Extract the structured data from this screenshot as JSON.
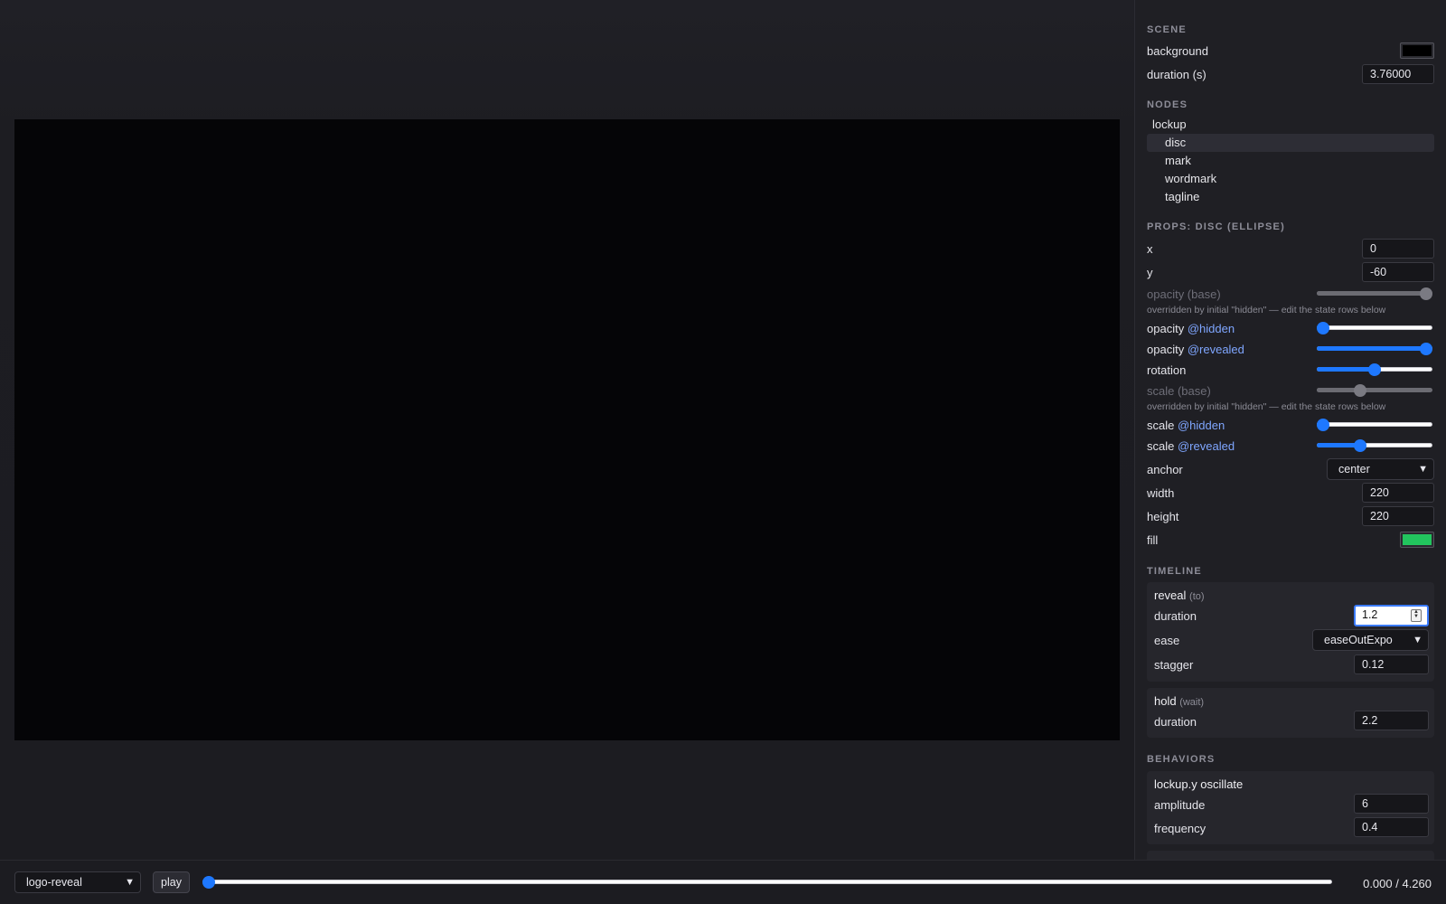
{
  "scene": {
    "title": "SCENE",
    "background_label": "background",
    "background_color": "#000000",
    "duration_label": "duration (s)",
    "duration_value": "3.76000"
  },
  "nodes": {
    "title": "NODES",
    "items": [
      {
        "label": "lockup",
        "depth": 0,
        "selected": false
      },
      {
        "label": "disc",
        "depth": 1,
        "selected": true
      },
      {
        "label": "mark",
        "depth": 1,
        "selected": false
      },
      {
        "label": "wordmark",
        "depth": 1,
        "selected": false
      },
      {
        "label": "tagline",
        "depth": 1,
        "selected": false
      }
    ]
  },
  "props": {
    "title": "PROPS: DISC (ELLIPSE)",
    "x_label": "x",
    "x_value": "0",
    "y_label": "y",
    "y_value": "-60",
    "override_note": "overridden by initial \"hidden\" — edit the state rows below",
    "opacity_base_label": "opacity (base)",
    "opacity_label": "opacity",
    "hidden_state": "@hidden",
    "revealed_state": "@revealed",
    "rotation_label": "rotation",
    "scale_base_label": "scale (base)",
    "scale_label": "scale",
    "anchor_label": "anchor",
    "anchor_value": "center",
    "width_label": "width",
    "width_value": "220",
    "height_label": "height",
    "height_value": "220",
    "fill_label": "fill",
    "fill_color": "#22c55e",
    "sliders": {
      "opacity_base": 1.0,
      "opacity_hidden": 0.0,
      "opacity_revealed": 1.0,
      "rotation": 0.5,
      "scale_base": 0.36,
      "scale_hidden": 0.0,
      "scale_revealed": 0.36
    }
  },
  "timeline": {
    "title": "TIMELINE",
    "reveal": {
      "name": "reveal",
      "kind": "(to)",
      "duration_label": "duration",
      "duration_value": "1.2",
      "ease_label": "ease",
      "ease_value": "easeOutExpo",
      "stagger_label": "stagger",
      "stagger_value": "0.12"
    },
    "hold": {
      "name": "hold",
      "kind": "(wait)",
      "duration_label": "duration",
      "duration_value": "2.2"
    }
  },
  "behaviors": {
    "title": "BEHAVIORS",
    "oscillate": {
      "name": "lockup.y oscillate",
      "amplitude_label": "amplitude",
      "amplitude_value": "6",
      "frequency_label": "frequency",
      "frequency_value": "0.4"
    }
  },
  "playback": {
    "scene_select": "logo-reveal",
    "play_label": "play",
    "progress": 0.0,
    "time_readout": "0.000 / 4.260"
  },
  "colors": {
    "accent": "#1e78ff",
    "state_text": "#7fa6ff"
  }
}
